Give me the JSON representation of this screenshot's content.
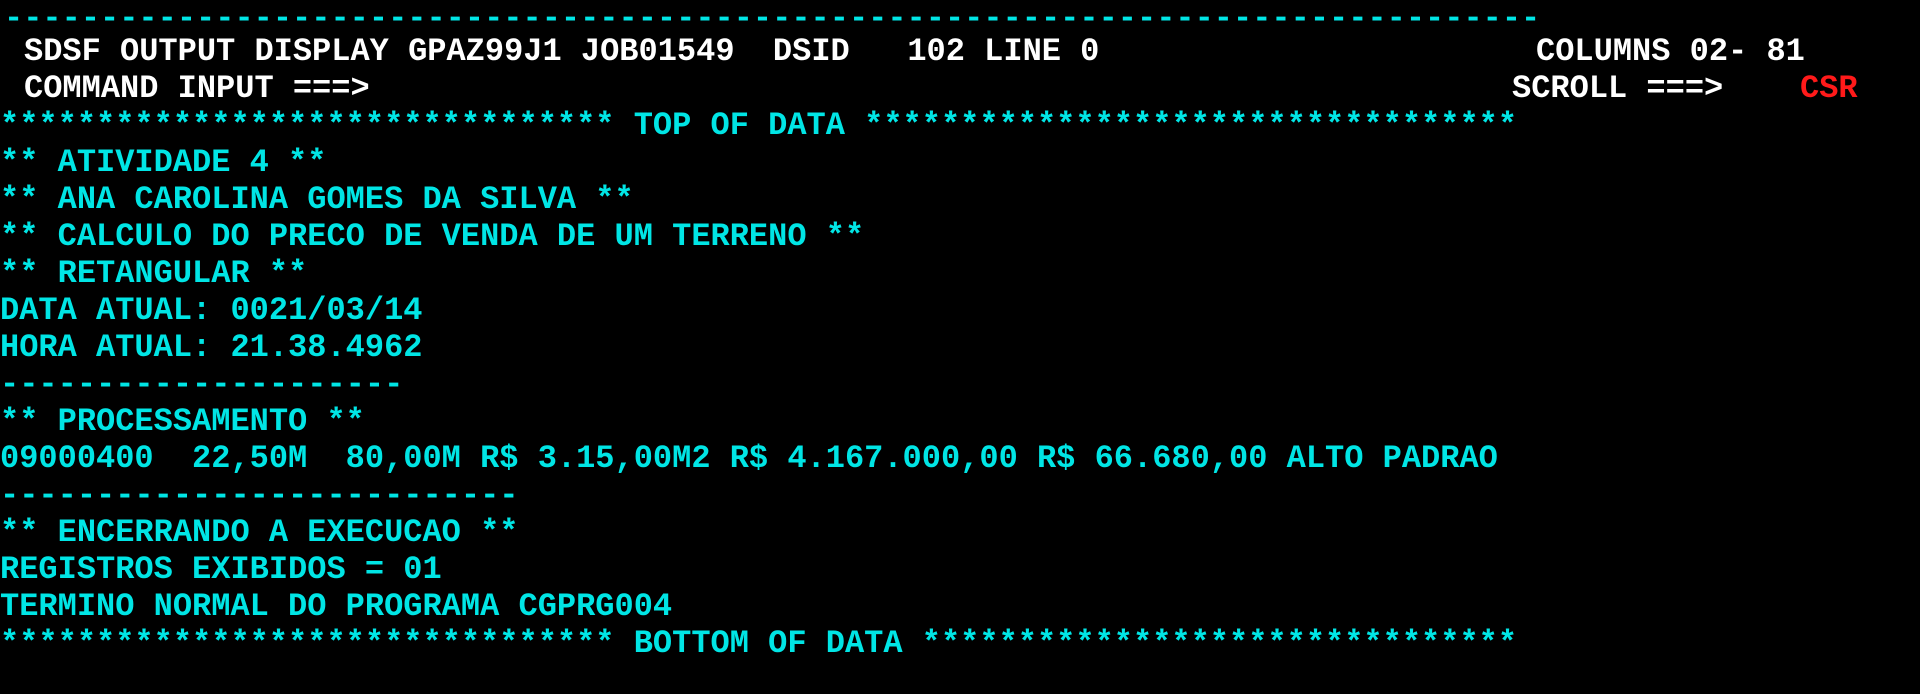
{
  "header": {
    "rule_top": "--------------------------------------------------------------------------------",
    "title": "SDSF OUTPUT DISPLAY GPAZ99J1 JOB01549  DSID   102 LINE 0",
    "columns": "COLUMNS 02- 81",
    "command_label": "COMMAND INPUT ===>",
    "scroll_label": "SCROLL ===>",
    "scroll_value": "CSR"
  },
  "colors": {
    "background": "#000000",
    "output_text": "#00e5e5",
    "header_text": "#ffffff",
    "scroll_value": "#ff1a1a"
  },
  "output": {
    "top_marker": "******************************** TOP OF DATA **********************************",
    "lines": [
      "** ATIVIDADE 4 **",
      "** ANA CAROLINA GOMES DA SILVA **",
      "** CALCULO DO PRECO DE VENDA DE UM TERRENO **",
      "** RETANGULAR **",
      "DATA ATUAL: 0021/03/14",
      "HORA ATUAL: 21.38.4962",
      "---------------------",
      "** PROCESSAMENTO **",
      "09000400  22,50M  80,00M R$ 3.15,00M2 R$ 4.167.000,00 R$ 66.680,00 ALTO PADRAO",
      "---------------------------",
      "** ENCERRANDO A EXECUCAO **",
      "REGISTROS EXIBIDOS = 01",
      "TERMINO NORMAL DO PROGRAMA CGPRG004"
    ],
    "bottom_marker": "******************************** BOTTOM OF DATA *******************************"
  }
}
